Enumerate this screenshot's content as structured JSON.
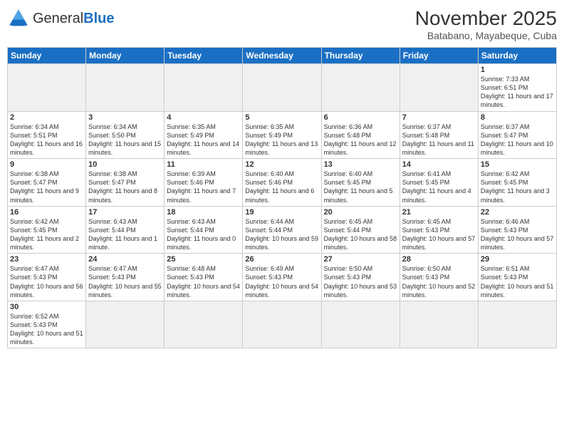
{
  "header": {
    "logo_general": "General",
    "logo_blue": "Blue",
    "month": "November 2025",
    "location": "Batabano, Mayabeque, Cuba"
  },
  "weekdays": [
    "Sunday",
    "Monday",
    "Tuesday",
    "Wednesday",
    "Thursday",
    "Friday",
    "Saturday"
  ],
  "days": [
    {
      "num": "",
      "info": "",
      "empty": true
    },
    {
      "num": "",
      "info": "",
      "empty": true
    },
    {
      "num": "",
      "info": "",
      "empty": true
    },
    {
      "num": "",
      "info": "",
      "empty": true
    },
    {
      "num": "",
      "info": "",
      "empty": true
    },
    {
      "num": "",
      "info": "",
      "empty": true
    },
    {
      "num": "1",
      "info": "Sunrise: 7:33 AM\nSunset: 6:51 PM\nDaylight: 11 hours and 17 minutes."
    },
    {
      "num": "2",
      "info": "Sunrise: 6:34 AM\nSunset: 5:51 PM\nDaylight: 11 hours and 16 minutes."
    },
    {
      "num": "3",
      "info": "Sunrise: 6:34 AM\nSunset: 5:50 PM\nDaylight: 11 hours and 15 minutes."
    },
    {
      "num": "4",
      "info": "Sunrise: 6:35 AM\nSunset: 5:49 PM\nDaylight: 11 hours and 14 minutes."
    },
    {
      "num": "5",
      "info": "Sunrise: 6:35 AM\nSunset: 5:49 PM\nDaylight: 11 hours and 13 minutes."
    },
    {
      "num": "6",
      "info": "Sunrise: 6:36 AM\nSunset: 5:48 PM\nDaylight: 11 hours and 12 minutes."
    },
    {
      "num": "7",
      "info": "Sunrise: 6:37 AM\nSunset: 5:48 PM\nDaylight: 11 hours and 11 minutes."
    },
    {
      "num": "8",
      "info": "Sunrise: 6:37 AM\nSunset: 5:47 PM\nDaylight: 11 hours and 10 minutes."
    },
    {
      "num": "9",
      "info": "Sunrise: 6:38 AM\nSunset: 5:47 PM\nDaylight: 11 hours and 9 minutes."
    },
    {
      "num": "10",
      "info": "Sunrise: 6:38 AM\nSunset: 5:47 PM\nDaylight: 11 hours and 8 minutes."
    },
    {
      "num": "11",
      "info": "Sunrise: 6:39 AM\nSunset: 5:46 PM\nDaylight: 11 hours and 7 minutes."
    },
    {
      "num": "12",
      "info": "Sunrise: 6:40 AM\nSunset: 5:46 PM\nDaylight: 11 hours and 6 minutes."
    },
    {
      "num": "13",
      "info": "Sunrise: 6:40 AM\nSunset: 5:45 PM\nDaylight: 11 hours and 5 minutes."
    },
    {
      "num": "14",
      "info": "Sunrise: 6:41 AM\nSunset: 5:45 PM\nDaylight: 11 hours and 4 minutes."
    },
    {
      "num": "15",
      "info": "Sunrise: 6:42 AM\nSunset: 5:45 PM\nDaylight: 11 hours and 3 minutes."
    },
    {
      "num": "16",
      "info": "Sunrise: 6:42 AM\nSunset: 5:45 PM\nDaylight: 11 hours and 2 minutes."
    },
    {
      "num": "17",
      "info": "Sunrise: 6:43 AM\nSunset: 5:44 PM\nDaylight: 11 hours and 1 minute."
    },
    {
      "num": "18",
      "info": "Sunrise: 6:43 AM\nSunset: 5:44 PM\nDaylight: 11 hours and 0 minutes."
    },
    {
      "num": "19",
      "info": "Sunrise: 6:44 AM\nSunset: 5:44 PM\nDaylight: 10 hours and 59 minutes."
    },
    {
      "num": "20",
      "info": "Sunrise: 6:45 AM\nSunset: 5:44 PM\nDaylight: 10 hours and 58 minutes."
    },
    {
      "num": "21",
      "info": "Sunrise: 6:45 AM\nSunset: 5:43 PM\nDaylight: 10 hours and 57 minutes."
    },
    {
      "num": "22",
      "info": "Sunrise: 6:46 AM\nSunset: 5:43 PM\nDaylight: 10 hours and 57 minutes."
    },
    {
      "num": "23",
      "info": "Sunrise: 6:47 AM\nSunset: 5:43 PM\nDaylight: 10 hours and 56 minutes."
    },
    {
      "num": "24",
      "info": "Sunrise: 6:47 AM\nSunset: 5:43 PM\nDaylight: 10 hours and 55 minutes."
    },
    {
      "num": "25",
      "info": "Sunrise: 6:48 AM\nSunset: 5:43 PM\nDaylight: 10 hours and 54 minutes."
    },
    {
      "num": "26",
      "info": "Sunrise: 6:49 AM\nSunset: 5:43 PM\nDaylight: 10 hours and 54 minutes."
    },
    {
      "num": "27",
      "info": "Sunrise: 6:50 AM\nSunset: 5:43 PM\nDaylight: 10 hours and 53 minutes."
    },
    {
      "num": "28",
      "info": "Sunrise: 6:50 AM\nSunset: 5:43 PM\nDaylight: 10 hours and 52 minutes."
    },
    {
      "num": "29",
      "info": "Sunrise: 6:51 AM\nSunset: 5:43 PM\nDaylight: 10 hours and 51 minutes."
    },
    {
      "num": "30",
      "info": "Sunrise: 6:52 AM\nSunset: 5:43 PM\nDaylight: 10 hours and 51 minutes."
    },
    {
      "num": "",
      "info": "",
      "empty": true
    },
    {
      "num": "",
      "info": "",
      "empty": true
    },
    {
      "num": "",
      "info": "",
      "empty": true
    },
    {
      "num": "",
      "info": "",
      "empty": true
    },
    {
      "num": "",
      "info": "",
      "empty": true
    },
    {
      "num": "",
      "info": "",
      "empty": true
    }
  ]
}
